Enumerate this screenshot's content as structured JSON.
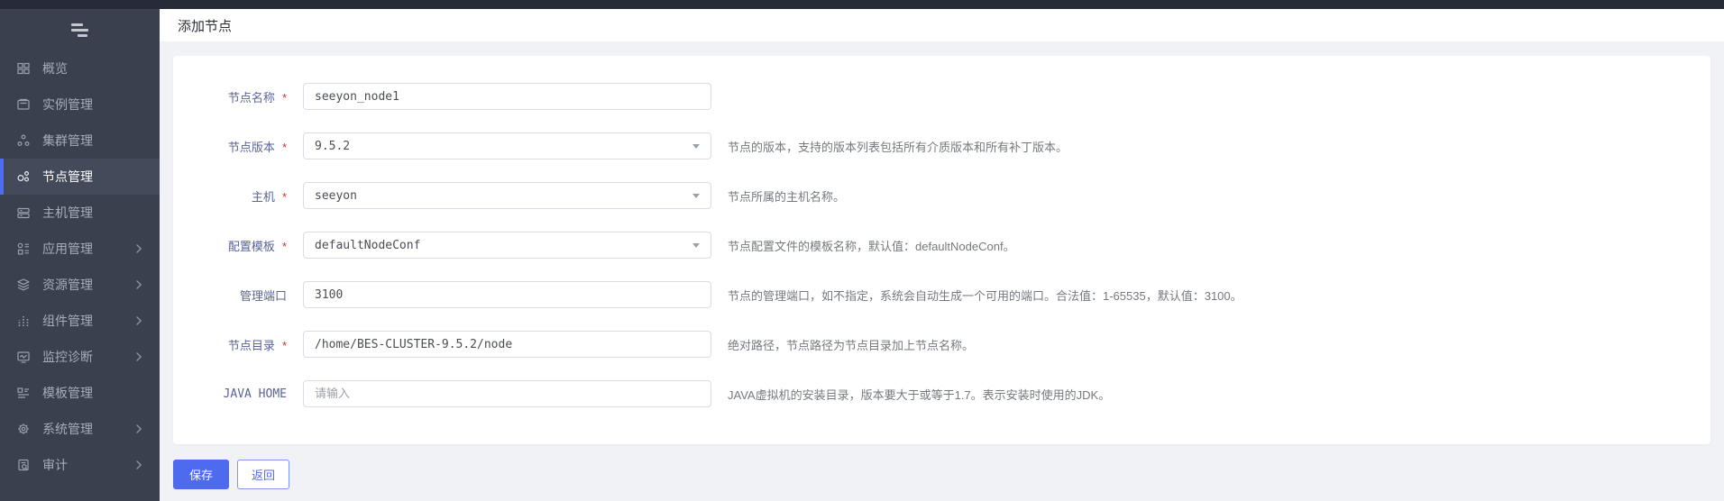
{
  "header": {
    "title": "添加节点"
  },
  "sidebar": {
    "items": [
      {
        "name": "overview",
        "icon": "overview-icon",
        "label": "概览",
        "active": false,
        "chevron": false
      },
      {
        "name": "instances",
        "icon": "instance-icon",
        "label": "实例管理",
        "active": false,
        "chevron": false
      },
      {
        "name": "clusters",
        "icon": "cluster-icon",
        "label": "集群管理",
        "active": false,
        "chevron": false
      },
      {
        "name": "nodes",
        "icon": "node-icon",
        "label": "节点管理",
        "active": true,
        "chevron": false
      },
      {
        "name": "hosts",
        "icon": "host-icon",
        "label": "主机管理",
        "active": false,
        "chevron": false
      },
      {
        "name": "apps",
        "icon": "app-icon",
        "label": "应用管理",
        "active": false,
        "chevron": true
      },
      {
        "name": "resources",
        "icon": "resource-icon",
        "label": "资源管理",
        "active": false,
        "chevron": true
      },
      {
        "name": "components",
        "icon": "component-icon",
        "label": "组件管理",
        "active": false,
        "chevron": true
      },
      {
        "name": "monitor",
        "icon": "monitor-icon",
        "label": "监控诊断",
        "active": false,
        "chevron": true
      },
      {
        "name": "templates",
        "icon": "template-icon",
        "label": "模板管理",
        "active": false,
        "chevron": false
      },
      {
        "name": "system",
        "icon": "system-icon",
        "label": "系统管理",
        "active": false,
        "chevron": true
      },
      {
        "name": "audit",
        "icon": "audit-icon",
        "label": "审计",
        "active": false,
        "chevron": true
      }
    ]
  },
  "form": {
    "fields": [
      {
        "name": "node-name",
        "label": "节点名称",
        "required": true,
        "type": "text",
        "value": "seeyon_node1",
        "placeholder": "",
        "help": ""
      },
      {
        "name": "node-version",
        "label": "节点版本",
        "required": true,
        "type": "select",
        "value": "9.5.2",
        "placeholder": "",
        "help": "节点的版本，支持的版本列表包括所有介质版本和所有补丁版本。"
      },
      {
        "name": "host",
        "label": "主机",
        "required": true,
        "type": "select",
        "value": "seeyon",
        "placeholder": "",
        "help": "节点所属的主机名称。"
      },
      {
        "name": "config-template",
        "label": "配置模板",
        "required": true,
        "type": "select",
        "value": "defaultNodeConf",
        "placeholder": "",
        "help": "节点配置文件的模板名称，默认值：defaultNodeConf。"
      },
      {
        "name": "admin-port",
        "label": "管理端口",
        "required": false,
        "type": "text",
        "value": "3100",
        "placeholder": "",
        "help": "节点的管理端口，如不指定，系统会自动生成一个可用的端口。合法值：1-65535，默认值：3100。"
      },
      {
        "name": "node-dir",
        "label": "节点目录",
        "required": true,
        "type": "text",
        "value": "/home/BES-CLUSTER-9.5.2/node",
        "placeholder": "",
        "help": "绝对路径，节点路径为节点目录加上节点名称。"
      },
      {
        "name": "java-home",
        "label": "JAVA HOME",
        "required": false,
        "type": "text",
        "value": "",
        "placeholder": "请输入",
        "help": "JAVA虚拟机的安装目录，版本要大于或等于1.7。表示安装时使用的JDK。"
      }
    ],
    "required_marker": "*",
    "buttons": {
      "save": "保存",
      "back": "返回"
    }
  },
  "colors": {
    "topbar": "#262b37",
    "sidebar_bg": "#3a404e",
    "sidebar_active_bg": "#434a59",
    "accent_blue": "#4e6ef2",
    "label_indigo": "#5a6496",
    "asterisk_red": "#c0392b",
    "helper_gray": "#75797f",
    "body_bg": "#f1f2f6",
    "input_border": "#d9dce3"
  }
}
